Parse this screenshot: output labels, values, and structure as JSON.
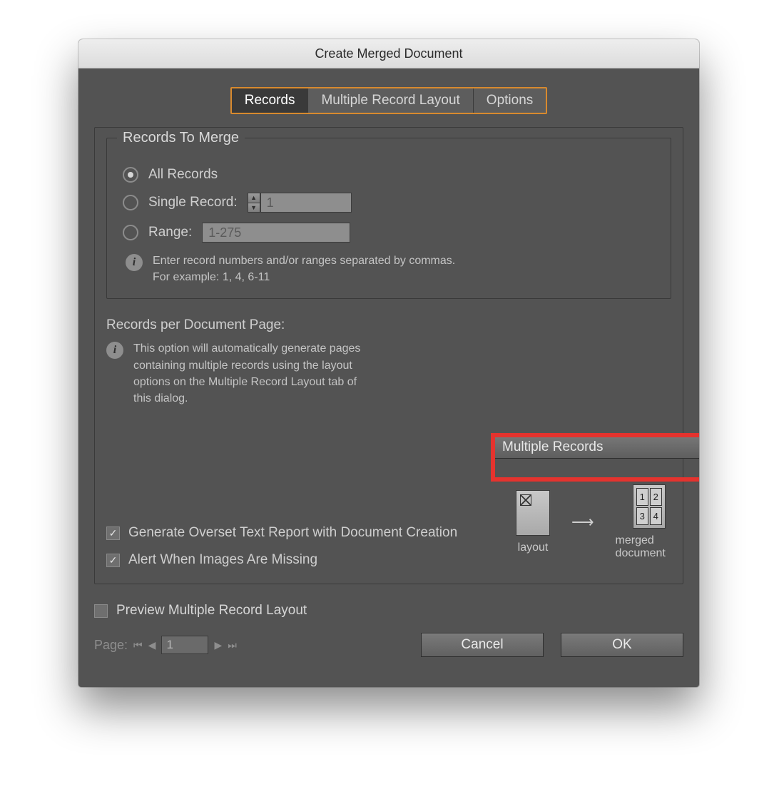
{
  "window": {
    "title": "Create Merged Document"
  },
  "tabs": {
    "records": "Records",
    "multiple_layout": "Multiple Record Layout",
    "options": "Options",
    "selected": "records"
  },
  "records_to_merge": {
    "legend": "Records To Merge",
    "all": "All Records",
    "single": "Single Record:",
    "single_value": "1",
    "range": "Range:",
    "range_value": "1-275",
    "hint": "Enter record numbers and/or ranges separated by commas. For example: 1, 4, 6-11",
    "selected": "all"
  },
  "records_per_page": {
    "label": "Records per Document Page:",
    "value": "Multiple Records",
    "hint": "This option will automatically generate pages containing multiple records using the layout options on the Multiple Record Layout tab of this dialog.",
    "layout_caption": "layout",
    "merged_caption": "merged document",
    "cells": [
      "1",
      "2",
      "3",
      "4"
    ]
  },
  "checks": {
    "overset": "Generate Overset Text Report with Document Creation",
    "overset_checked": true,
    "missing": "Alert When Images Are Missing",
    "missing_checked": true
  },
  "preview": {
    "label": "Preview Multiple Record Layout",
    "checked": false
  },
  "pager": {
    "label": "Page:",
    "value": "1"
  },
  "buttons": {
    "cancel": "Cancel",
    "ok": "OK"
  }
}
